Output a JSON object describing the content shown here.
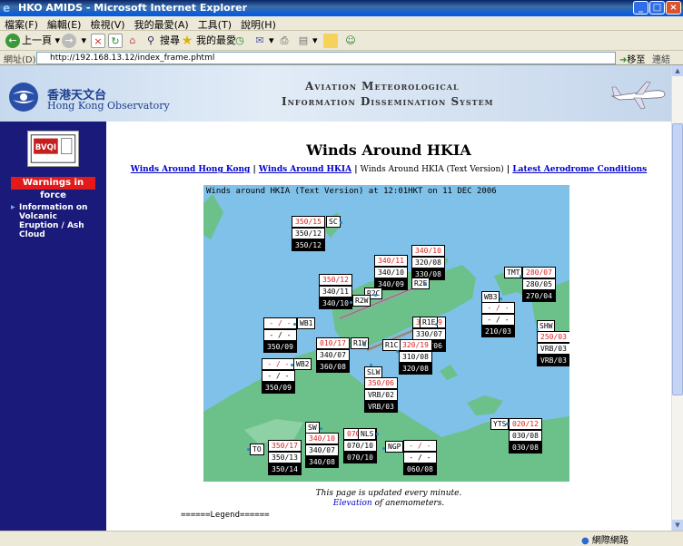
{
  "window": {
    "title": "HKO AMIDS - Microsoft Internet Explorer"
  },
  "menu": [
    "檔案(F)",
    "編輯(E)",
    "檢視(V)",
    "我的最愛(A)",
    "工具(T)",
    "說明(H)"
  ],
  "toolbar": {
    "back": "上一頁",
    "search": "搜尋",
    "favorites": "我的最愛"
  },
  "address": {
    "label": "網址(D)",
    "url": "http://192.168.13.12/index_frame.phtml",
    "go": "移至",
    "links": "連結"
  },
  "banner": {
    "logo_cn": "香港天文台",
    "logo_en": "Hong Kong Observatory",
    "system_line1": "Aviation Meteorological",
    "system_line2": "Information Dissemination System"
  },
  "sidebar": {
    "warnings": "Warnings in force",
    "volcanic": "Information on Volcanic Eruption / Ash Cloud"
  },
  "page": {
    "title": "Winds Around HKIA",
    "nav": [
      "Winds Around Hong Kong",
      "Winds Around HKIA",
      "Winds Around HKIA (Text Version)",
      "Latest Aerodrome Conditions"
    ],
    "map_header": "Winds around HKIA (Text Version) at 12:01HKT on 11 DEC 2006",
    "update_note": "This page is updated every minute.",
    "elev_link": "Elevation ",
    "elev_rest": "of anemometers.",
    "legend": "======Legend======"
  },
  "stations": [
    {
      "id": "SC",
      "r": "350/15",
      "w": "350/12",
      "k": "350/12"
    },
    {
      "id": "R2E",
      "r": "340/10",
      "w": "320/08",
      "k": "330/08"
    },
    {
      "id": "R2C",
      "r": "340/11",
      "w": "340/10",
      "k": "340/09"
    },
    {
      "id": "R2W",
      "r": "350/12",
      "w": "340/11",
      "k": "340/10"
    },
    {
      "id": "TMT",
      "r": "280/07",
      "w": "280/05",
      "k": "270/04"
    },
    {
      "id": "WB3",
      "r": "- / -",
      "w": "- / -",
      "k": "210/03"
    },
    {
      "id": "WB1",
      "r": "- / -",
      "w": "- / -",
      "k": "350/09"
    },
    {
      "id": "R1E",
      "r": "310/09",
      "w": "330/07",
      "k": "330/06"
    },
    {
      "id": "SHW",
      "r": "250/03",
      "w": "VRB/03",
      "k": "VRB/03"
    },
    {
      "id": "R1W",
      "r": "010/17",
      "w": "340/07",
      "k": "360/08"
    },
    {
      "id": "R1C",
      "r": "320/19",
      "w": "310/08",
      "k": "320/08"
    },
    {
      "id": "WB2",
      "r": "- / -",
      "w": "- / -",
      "k": "350/09"
    },
    {
      "id": "SLW",
      "r": "350/06",
      "w": "VRB/02",
      "k": "VRB/03"
    },
    {
      "id": "SW",
      "r": "340/10",
      "w": "340/07",
      "k": "340/08"
    },
    {
      "id": "NLS",
      "r": "070/13",
      "w": "070/10",
      "k": "070/10"
    },
    {
      "id": "NGP",
      "r": "- / -",
      "w": "- / -",
      "k": "060/08"
    },
    {
      "id": "YTS",
      "r": "020/12",
      "w": "030/08",
      "k": "030/08"
    },
    {
      "id": "TO",
      "r": "350/17",
      "w": "350/13",
      "k": "350/14"
    }
  ],
  "status": {
    "zone": "網際網路"
  }
}
